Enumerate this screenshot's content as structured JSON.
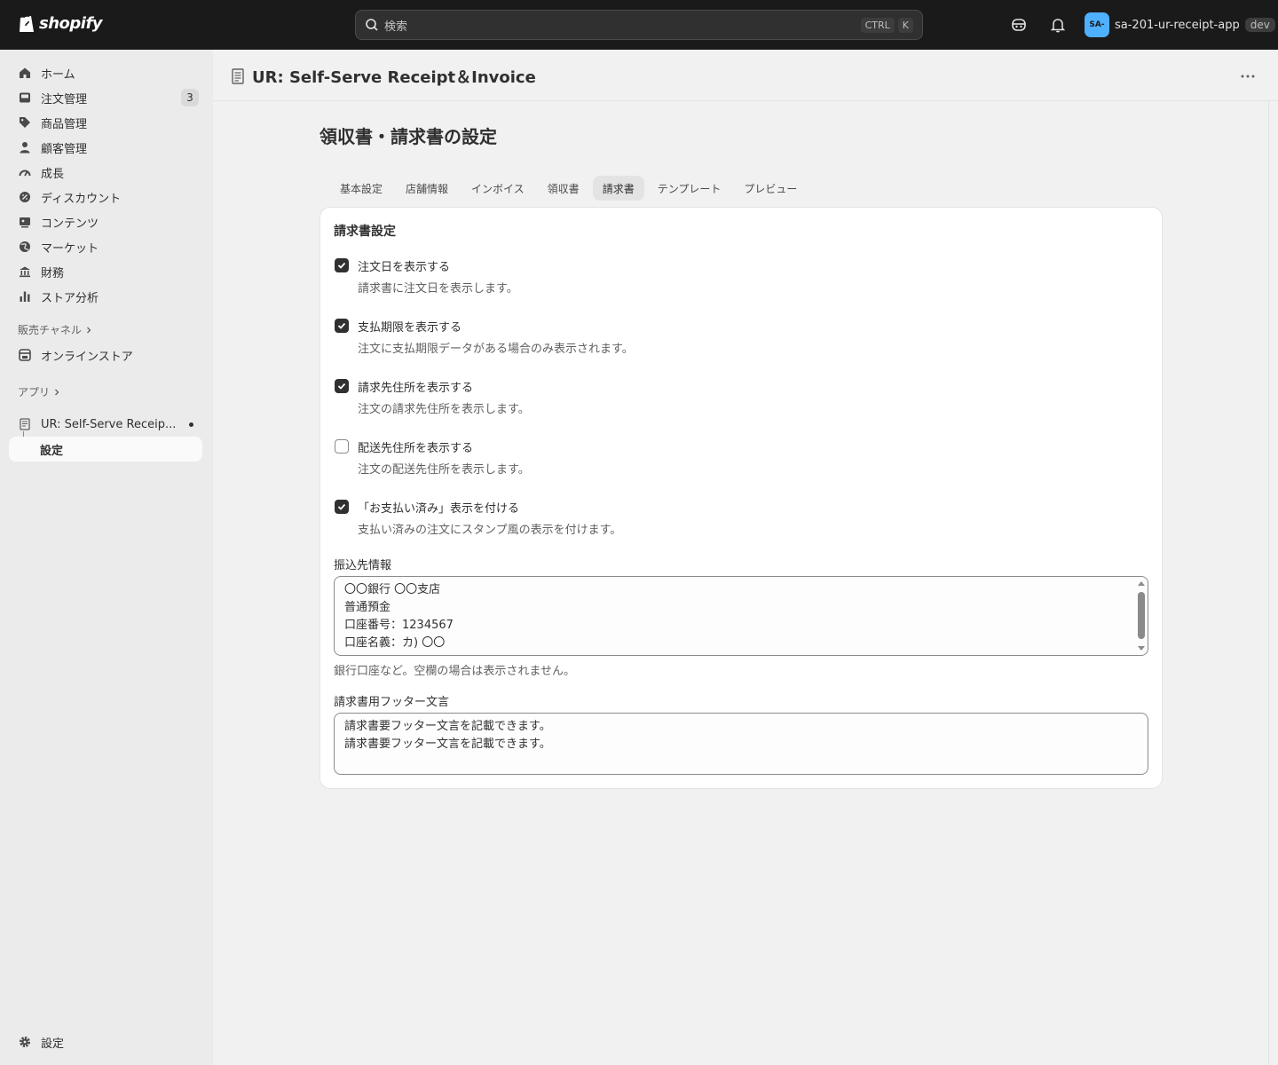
{
  "topbar": {
    "brand": "shopify",
    "search_placeholder": "検索",
    "shortcut_key1": "CTRL",
    "shortcut_key2": "K",
    "avatar_initials": "SA-",
    "store_name": "sa-201-ur-receipt-app",
    "env_badge": "dev"
  },
  "sidebar": {
    "items": [
      {
        "label": "ホーム",
        "icon": "home-icon"
      },
      {
        "label": "注文管理",
        "icon": "inbox-icon",
        "count": "3"
      },
      {
        "label": "商品管理",
        "icon": "tag-icon"
      },
      {
        "label": "顧客管理",
        "icon": "person-icon"
      },
      {
        "label": "成長",
        "icon": "gauge-icon"
      },
      {
        "label": "ディスカウント",
        "icon": "discount-icon"
      },
      {
        "label": "コンテンツ",
        "icon": "content-icon"
      },
      {
        "label": "マーケット",
        "icon": "globe-icon"
      },
      {
        "label": "財務",
        "icon": "bank-icon"
      },
      {
        "label": "ストア分析",
        "icon": "bar-chart-icon"
      }
    ],
    "sales_channels_label": "販売チャネル",
    "online_store_label": "オンラインストア",
    "apps_label": "アプリ",
    "app_item_label": "UR: Self-Serve Receip...",
    "app_sub_label": "設定",
    "settings_label": "設定"
  },
  "header": {
    "app_title": "UR: Self-Serve Receipt＆Invoice"
  },
  "page": {
    "title": "領収書・請求書の設定",
    "tabs": [
      "基本設定",
      "店舗情報",
      "インボイス",
      "領収書",
      "請求書",
      "テンプレート",
      "プレビュー"
    ],
    "active_tab": "請求書"
  },
  "card": {
    "title": "請求書設定",
    "options": [
      {
        "label": "注文日を表示する",
        "help": "請求書に注文日を表示します。",
        "checked": true
      },
      {
        "label": "支払期限を表示する",
        "help": "注文に支払期限データがある場合のみ表示されます。",
        "checked": true
      },
      {
        "label": "請求先住所を表示する",
        "help": "注文の請求先住所を表示します。",
        "checked": true
      },
      {
        "label": "配送先住所を表示する",
        "help": "注文の配送先住所を表示します。",
        "checked": false
      },
      {
        "label": "「お支払い済み」表示を付ける",
        "help": "支払い済みの注文にスタンプ風の表示を付けます。",
        "checked": true
      }
    ],
    "bank_info_label": "振込先情報",
    "bank_info_lines": [
      "〇〇銀行 〇〇支店",
      "普通預金",
      "口座番号：1234567",
      "口座名義：カ) 〇〇"
    ],
    "bank_info_help": "銀行口座など。空欄の場合は表示されません。",
    "footer_label": "請求書用フッター文言",
    "footer_lines": [
      "請求書要フッター文言を記載できます。",
      "請求書要フッター文言を記載できます。"
    ]
  }
}
